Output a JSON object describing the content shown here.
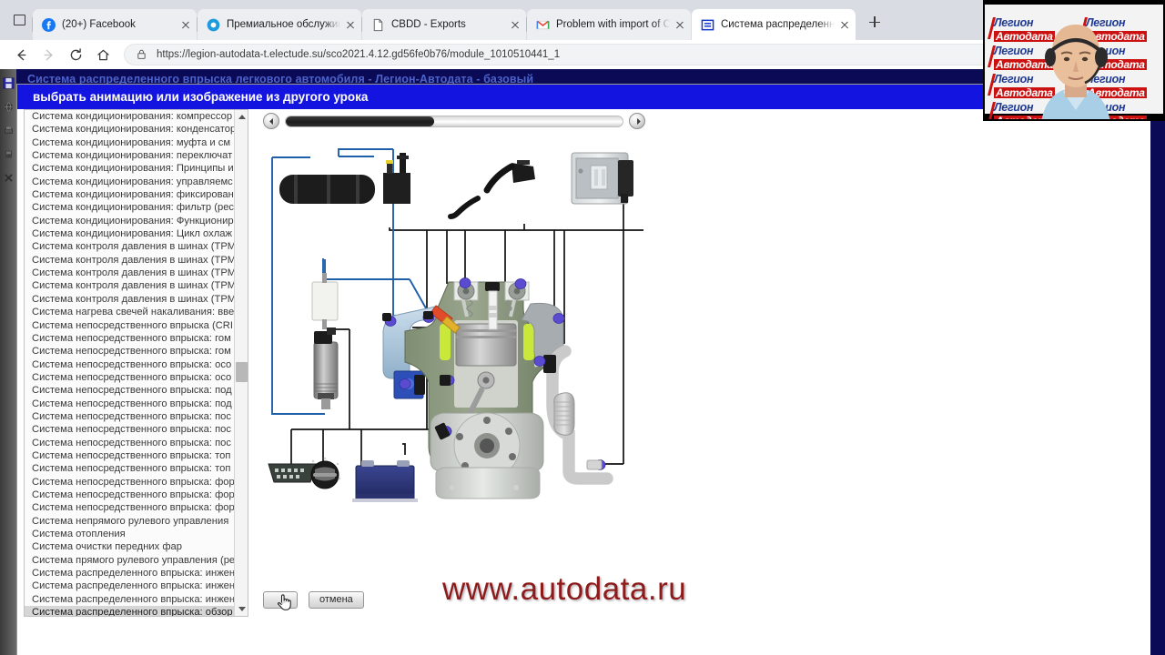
{
  "browser": {
    "tabs": [
      {
        "label": "(20+) Facebook",
        "favicon": "facebook-icon",
        "active": false
      },
      {
        "label": "Премиальное обслуживание —",
        "favicon": "blue-circle-icon",
        "active": false
      },
      {
        "label": "CBDD - Exports",
        "favicon": "document-icon",
        "active": false
      },
      {
        "label": "Problem with import of CSV files",
        "favicon": "gmail-icon",
        "active": false
      },
      {
        "label": "Система распределенного впр",
        "favicon": "blue-doc-icon",
        "active": true
      }
    ],
    "new_tab_label": "+",
    "tab_list_button": "tab-list-icon",
    "nav": {
      "back": "back-arrow-icon",
      "forward": "forward-arrow-icon",
      "reload": "reload-icon",
      "home": "home-icon"
    },
    "address": {
      "lock_icon": "lock-icon",
      "url": "https://legion-autodata-t.electude.su/sco2021.4.12.gd56fe0b76/module_1010510441_1",
      "favorite_icon": "star-icon"
    }
  },
  "app": {
    "window_title": "Система распределенного впрыска легкового автомобиля - Легион-Автодата - базовый",
    "left_toolbar": [
      {
        "icon": "save-icon"
      },
      {
        "icon": "globe-icon"
      },
      {
        "icon": "print-icon"
      },
      {
        "icon": "book-icon"
      },
      {
        "icon": "close-icon"
      }
    ]
  },
  "dialog": {
    "title": "выбрать анимацию или изображение из другого урока",
    "list": {
      "items": [
        "Система кондиционирования: компрессор",
        "Система кондиционирования: конденсатор",
        "Система кондиционирования: муфта и см",
        "Система кондиционирования: переключат",
        "Система кондиционирования: Принципы и",
        "Система кондиционирования: управляемс",
        "Система кондиционирования: фиксирован",
        "Система кондиционирования: фильтр (рес",
        "Система кондиционирования: Функционир",
        "Система кондиционирования: Цикл охлаж",
        "Система контроля давления в шинах (TPM",
        "Система контроля давления в шинах (TPM",
        "Система контроля давления в шинах (TPM",
        "Система контроля давления в шинах (TPM",
        "Система контроля давления в шинах (TPM",
        "Система нагрева свечей накаливания: вве",
        "Система непосредственного впрыска (CRI",
        "Система непосредственного впрыска: гом",
        "Система непосредственного впрыска: гом",
        "Система непосредственного впрыска: осо",
        "Система непосредственного впрыска: осо",
        "Система непосредственного впрыска: под",
        "Система непосредственного впрыска: под",
        "Система непосредственного впрыска: пос",
        "Система непосредственного впрыска: пос",
        "Система непосредственного впрыска: пос",
        "Система непосредственного впрыска: топ",
        "Система непосредственного впрыска: топ",
        "Система непосредственного впрыска: фор",
        "Система непосредственного впрыска: фор",
        "Система непосредственного впрыска: фор",
        "Система непрямого рулевого управления",
        "Система отопления",
        "Система очистки передних фар",
        "Система прямого рулевого управления (ре",
        "Система распределенного впрыска: инжен",
        "Система распределенного впрыска: инжен",
        "Система распределенного впрыска: инжен",
        "Система распределенного впрыска: обзор"
      ],
      "selected_index": 38,
      "scroll_up_icon": "scroll-up-arrow-icon",
      "scroll_down_icon": "scroll-down-arrow-icon",
      "thumb_position_pct": 52
    },
    "slider": {
      "prev_icon": "slider-prev-icon",
      "next_icon": "slider-next-icon",
      "fill_pct": 44
    },
    "buttons": [
      {
        "label": "",
        "name": "select-button",
        "cursor": "hand-cursor-icon"
      },
      {
        "label": "отмена",
        "name": "cancel-button",
        "cursor": ""
      }
    ],
    "watermark": "www.autodata.ru",
    "diagram": {
      "alt": "Схема системы распределенного впрыска легкового автомобиля",
      "parts": [
        "угольный адсорбер",
        "клапан продувки адсорбера",
        "педаль акселератора с датчиком",
        "блок управления двигателем (ЭБУ)",
        "топливный фильтр",
        "топливный насос",
        "впускной коллектор",
        "форсунка",
        "катушка зажигания / свеча",
        "дроссельная заслонка",
        "датчик детонации",
        "датчик положения коленчатого вала",
        "лямбда-зонд",
        "каталитический нейтрализатор",
        "диагностический разъём OBD",
        "замок зажигания",
        "аккумуляторная батарея"
      ]
    }
  },
  "webcam": {
    "brand_line1": "Легион",
    "brand_line2": "Автодата",
    "person": "presenter-with-headset"
  },
  "colors": {
    "dialog_title_bg": "#1414e0",
    "app_bg": "#0a0a57",
    "app_title_text": "#4d63c9",
    "watermark": "#8e1b1b",
    "brand_red": "#cc1111",
    "brand_blue": "#1f3a93",
    "selection": "#d6d6d6"
  }
}
